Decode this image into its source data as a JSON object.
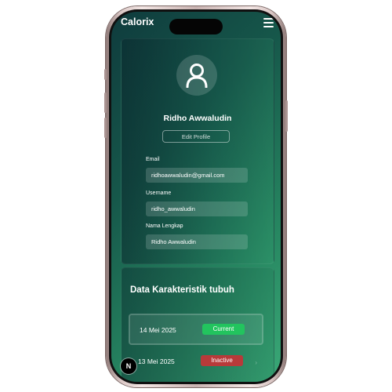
{
  "app": {
    "title": "Calorix"
  },
  "profile": {
    "name": "Ridho Awwaludin",
    "edit_label": "Edit Profile",
    "fields": {
      "email": {
        "label": "Email",
        "value": "ridhoawwaludin@gmail.com"
      },
      "username": {
        "label": "Username",
        "value": "ridho_awwaludin"
      },
      "full_name": {
        "label": "Nama Lengkap",
        "value": "Ridho Awwaludin"
      }
    }
  },
  "body_data": {
    "title": "Data Karakteristik tubuh",
    "records": [
      {
        "date": "14 Mei 2025",
        "status": "Current",
        "status_color": "#22c45e"
      },
      {
        "date": "13 Mei 2025",
        "status": "Inactive",
        "status_color": "#b83a3a"
      }
    ]
  },
  "overlay": {
    "logo_letter": "N"
  },
  "colors": {
    "accent_green": "#22c45e",
    "inactive_red": "#b83a3a",
    "gradient_start": "#0f3b3d",
    "gradient_end": "#3aa977"
  }
}
